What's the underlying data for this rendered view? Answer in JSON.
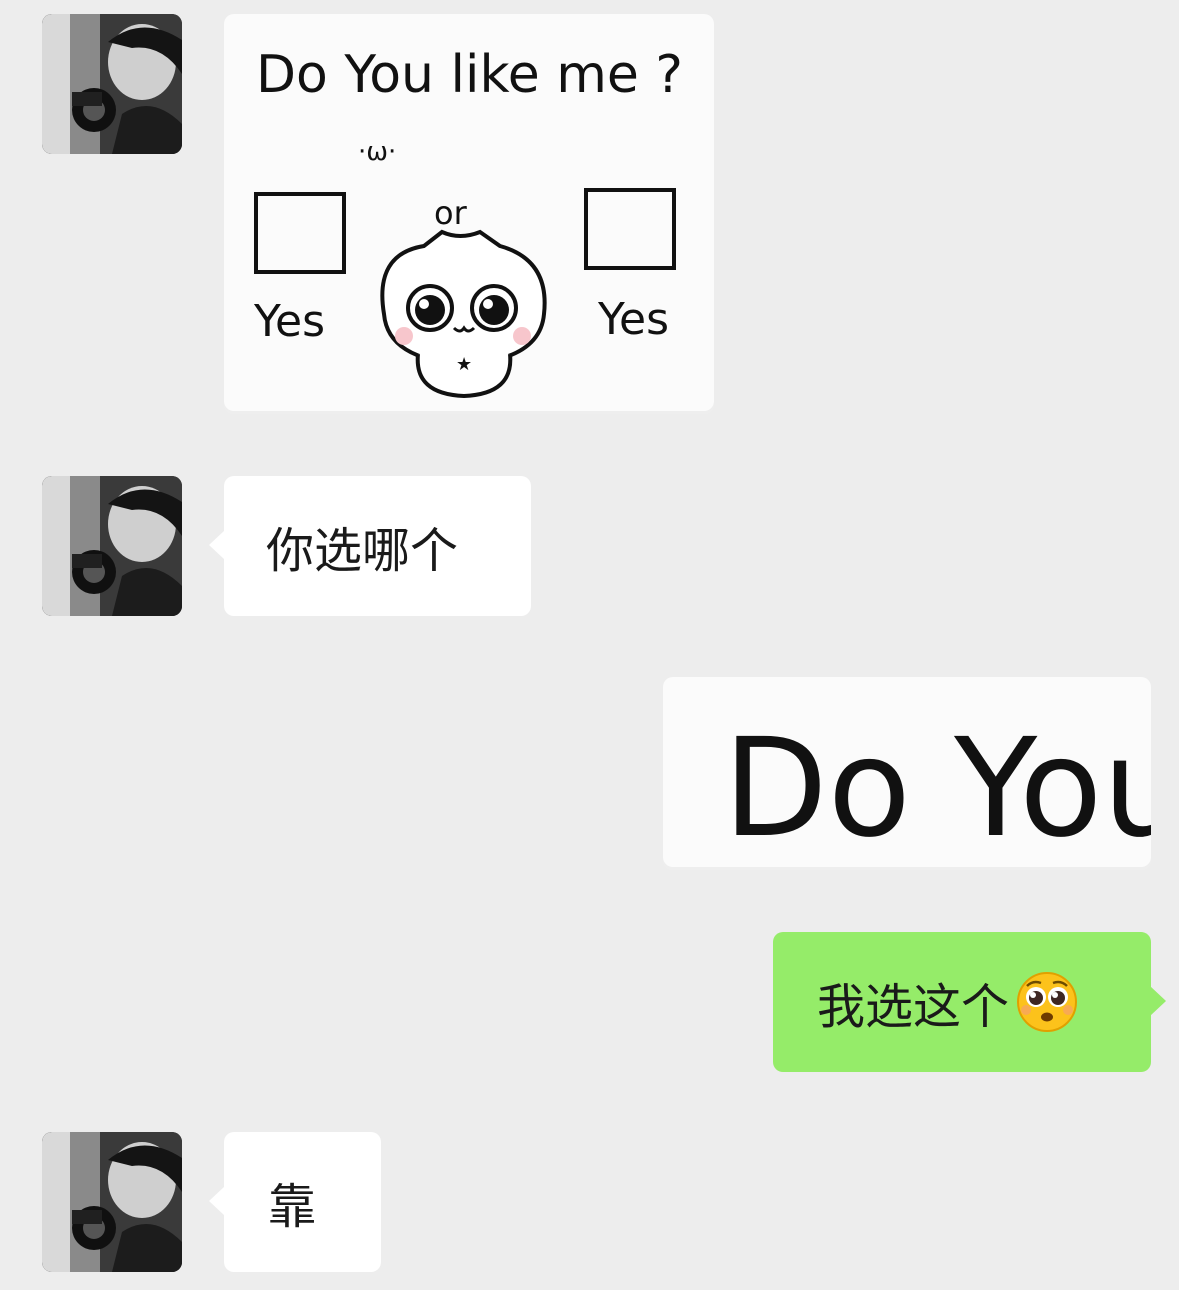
{
  "chat": {
    "messages": [
      {
        "sender": "contact",
        "kind": "sticker",
        "sticker": {
          "title": "Do You like me ?",
          "face": "·ω·",
          "or_label": "or",
          "left_option": "Yes",
          "right_option": "Yes"
        }
      },
      {
        "sender": "contact",
        "kind": "text",
        "text": "你选哪个"
      },
      {
        "sender": "me",
        "kind": "sticker",
        "sticker": {
          "title": "Do You"
        }
      },
      {
        "sender": "me",
        "kind": "text",
        "text": "我选这个",
        "emoji": "pleading-face-emoji"
      },
      {
        "sender": "contact",
        "kind": "text",
        "text": "靠"
      }
    ]
  },
  "colors": {
    "background": "#ededed",
    "incoming_bubble": "#ffffff",
    "outgoing_bubble": "#95ec69",
    "text": "#1a1a1a"
  }
}
